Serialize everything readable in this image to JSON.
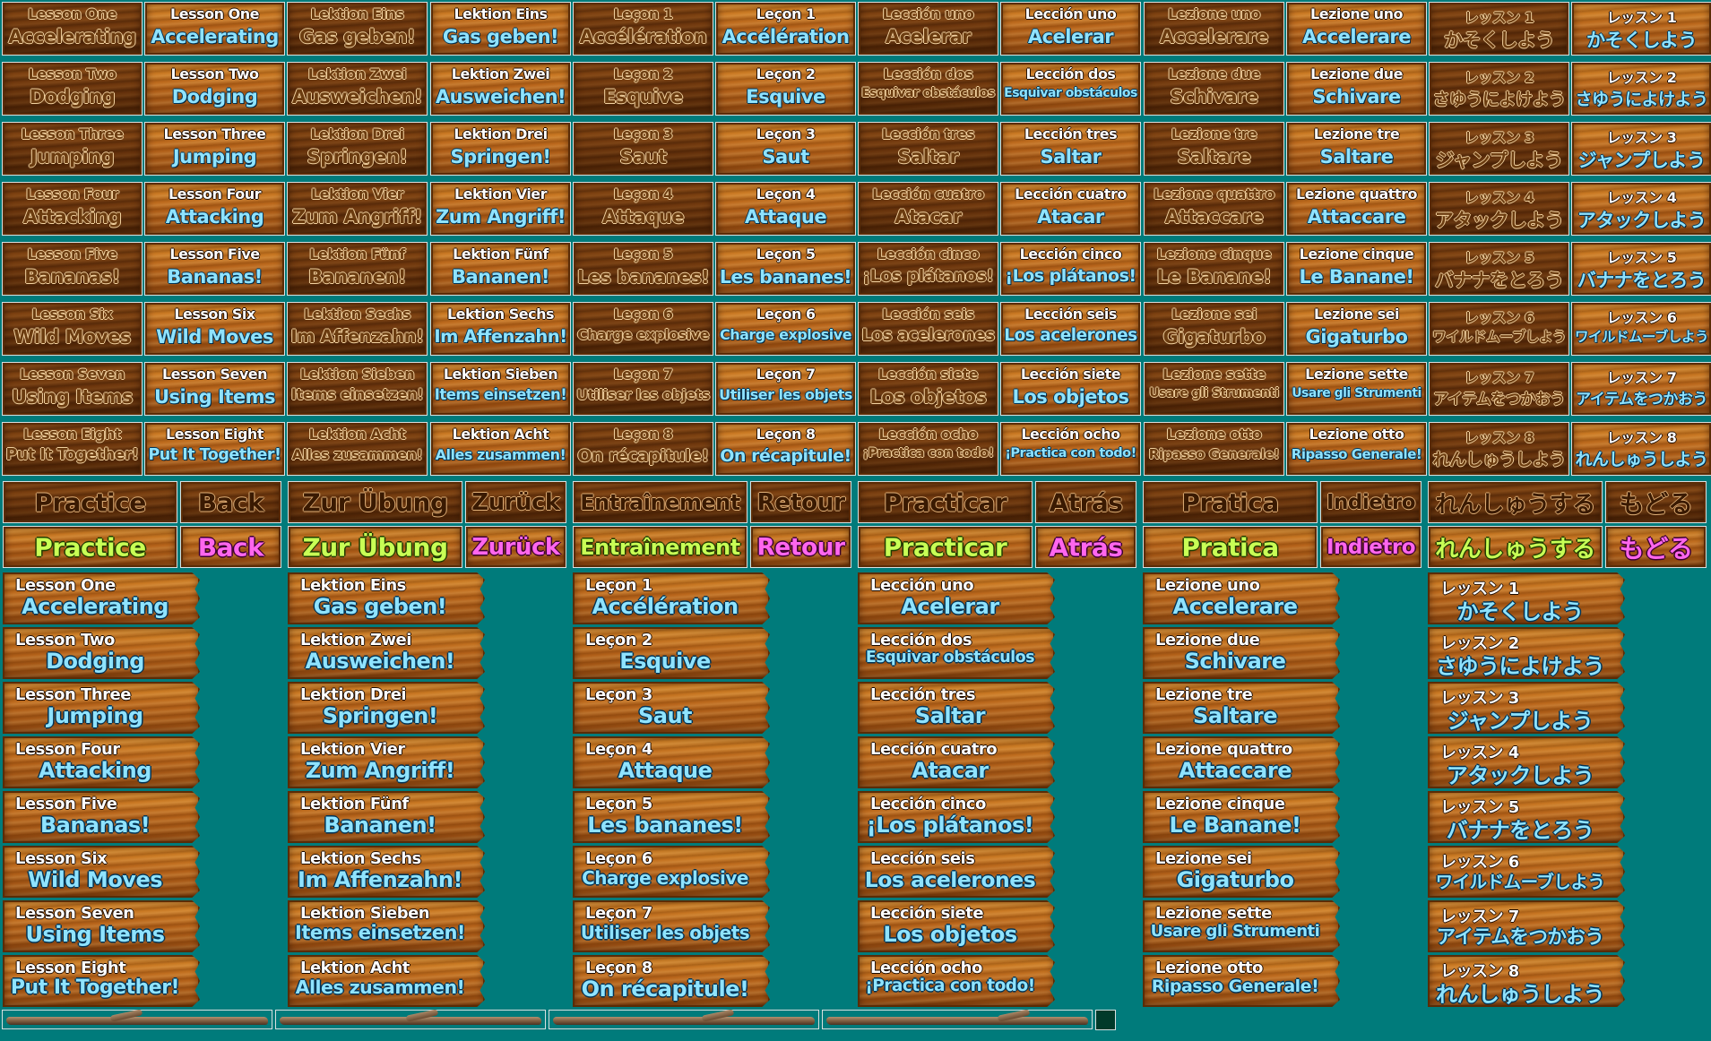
{
  "languages": [
    {
      "code": "en",
      "lessons": [
        [
          "Lesson One",
          "Accelerating"
        ],
        [
          "Lesson Two",
          "Dodging"
        ],
        [
          "Lesson Three",
          "Jumping"
        ],
        [
          "Lesson Four",
          "Attacking"
        ],
        [
          "Lesson Five",
          "Bananas!"
        ],
        [
          "Lesson Six",
          "Wild Moves"
        ],
        [
          "Lesson Seven",
          "Using Items"
        ],
        [
          "Lesson Eight",
          "Put It Together!"
        ]
      ],
      "practice": "Practice",
      "back": "Back"
    },
    {
      "code": "de",
      "lessons": [
        [
          "Lektion Eins",
          "Gas geben!"
        ],
        [
          "Lektion Zwei",
          "Ausweichen!"
        ],
        [
          "Lektion Drei",
          "Springen!"
        ],
        [
          "Lektion Vier",
          "Zum Angriff!"
        ],
        [
          "Lektion Fünf",
          "Bananen!"
        ],
        [
          "Lektion Sechs",
          "Im Affenzahn!"
        ],
        [
          "Lektion Sieben",
          "Items einsetzen!"
        ],
        [
          "Lektion Acht",
          "Alles zusammen!"
        ]
      ],
      "practice": "Zur Übung",
      "back": "Zurück"
    },
    {
      "code": "fr",
      "lessons": [
        [
          "Leçon 1",
          "Accélération"
        ],
        [
          "Leçon 2",
          "Esquive"
        ],
        [
          "Leçon 3",
          "Saut"
        ],
        [
          "Leçon 4",
          "Attaque"
        ],
        [
          "Leçon 5",
          "Les bananes!"
        ],
        [
          "Leçon 6",
          "Charge explosive"
        ],
        [
          "Leçon 7",
          "Utiliser les objets"
        ],
        [
          "Leçon 8",
          "On récapitule!"
        ]
      ],
      "practice": "Entraînement",
      "back": "Retour"
    },
    {
      "code": "es",
      "lessons": [
        [
          "Lección uno",
          "Acelerar"
        ],
        [
          "Lección dos",
          "Esquivar obstáculos"
        ],
        [
          "Lección tres",
          "Saltar"
        ],
        [
          "Lección cuatro",
          "Atacar"
        ],
        [
          "Lección cinco",
          "¡Los plátanos!"
        ],
        [
          "Lección seis",
          "Los acelerones"
        ],
        [
          "Lección siete",
          "Los objetos"
        ],
        [
          "Lección ocho",
          "¡Practica con todo!"
        ]
      ],
      "practice": "Practicar",
      "back": "Atrás"
    },
    {
      "code": "it",
      "lessons": [
        [
          "Lezione uno",
          "Accelerare"
        ],
        [
          "Lezione due",
          "Schivare"
        ],
        [
          "Lezione tre",
          "Saltare"
        ],
        [
          "Lezione quattro",
          "Attaccare"
        ],
        [
          "Lezione cinque",
          "Le Banane!"
        ],
        [
          "Lezione sei",
          "Gigaturbo"
        ],
        [
          "Lezione sette",
          "Usare gli Strumenti"
        ],
        [
          "Lezione otto",
          "Ripasso Generale!"
        ]
      ],
      "practice": "Pratica",
      "back": "Indietro"
    },
    {
      "code": "ja",
      "lessons": [
        [
          "レッスン 1",
          "かそくしよう"
        ],
        [
          "レッスン 2",
          "さゆうによけよう"
        ],
        [
          "レッスン 3",
          "ジャンプしよう"
        ],
        [
          "レッスン 4",
          "アタックしよう"
        ],
        [
          "レッスン 5",
          "バナナをとろう"
        ],
        [
          "レッスン 6",
          "ワイルドムーブしよう"
        ],
        [
          "レッスン 7",
          "アイテムをつかおう"
        ],
        [
          "レッスン 8",
          "れんしゅうしよう"
        ]
      ],
      "practice": "れんしゅうする",
      "back": "もどる"
    }
  ],
  "colors": {
    "background": "#007b7b",
    "primary_label": "#c8ff55",
    "back_label": "#ff66ee",
    "subtitle": "#8fe3ff"
  },
  "icons": {
    "sticks": [
      "branch-stick",
      "branch-stick",
      "branch-stick",
      "branch-stick"
    ],
    "swatch": "dark-green-swatch"
  }
}
